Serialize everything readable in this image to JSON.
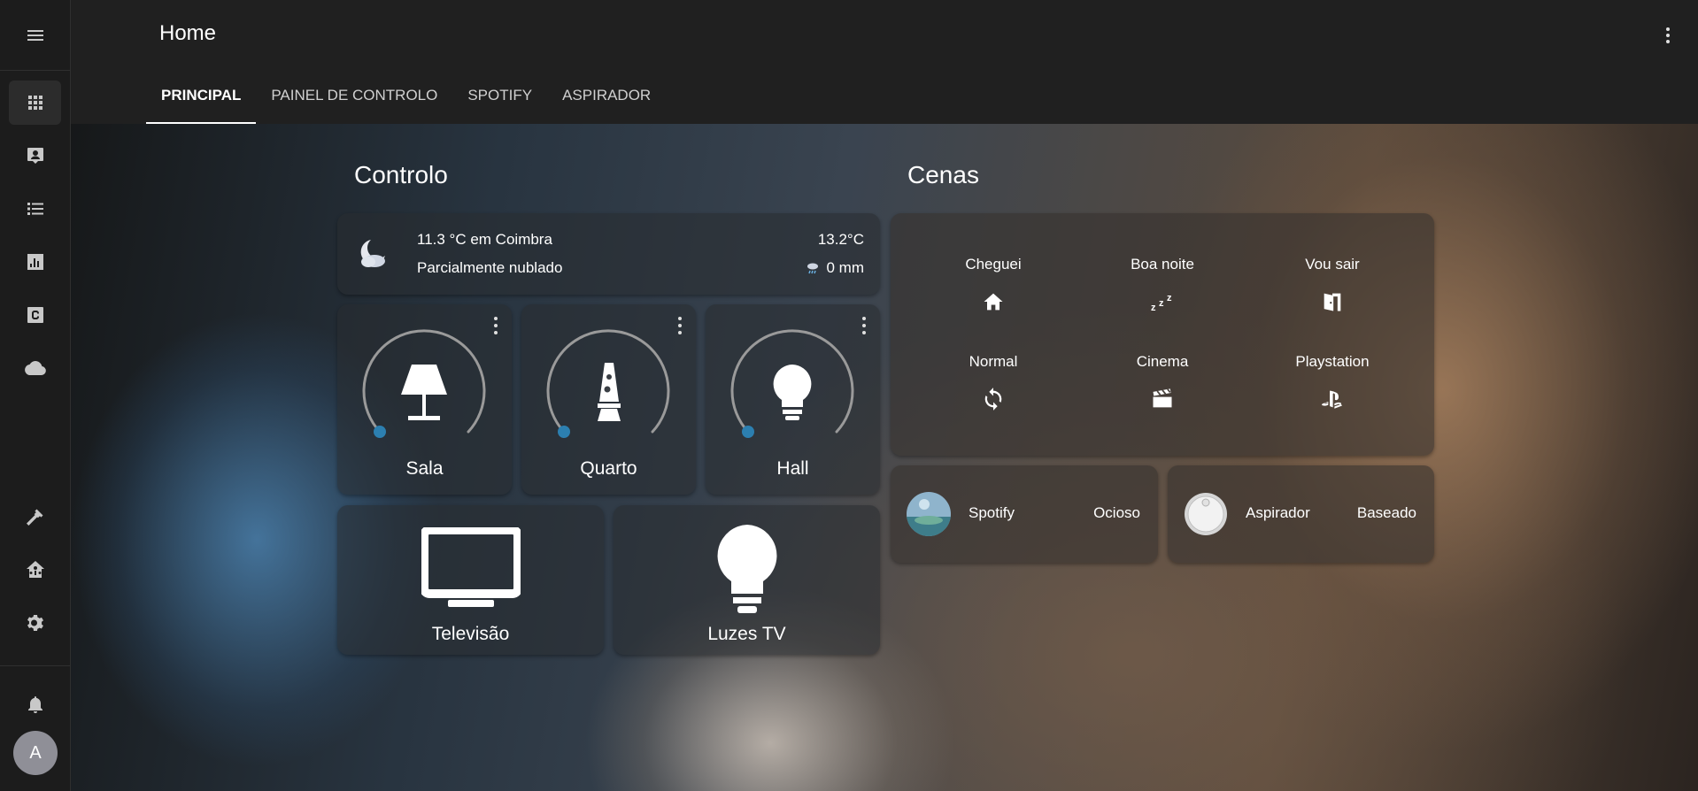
{
  "app": {
    "title": "Home"
  },
  "sidebar": {
    "menu_icon": "menu-icon",
    "items": [
      {
        "icon": "grid-icon",
        "active": true
      },
      {
        "icon": "person-board-icon"
      },
      {
        "icon": "list-icon"
      },
      {
        "icon": "bar-chart-icon"
      },
      {
        "icon": "c-box-icon"
      },
      {
        "icon": "cloud-icon"
      },
      {
        "icon": "hammer-icon"
      },
      {
        "icon": "home-assistant-icon"
      },
      {
        "icon": "gear-icon"
      },
      {
        "icon": "bell-icon"
      }
    ],
    "avatar_initial": "A"
  },
  "tabs": [
    {
      "label": "PRINCIPAL",
      "active": true
    },
    {
      "label": "PAINEL DE CONTROLO"
    },
    {
      "label": "SPOTIFY"
    },
    {
      "label": "ASPIRADOR"
    }
  ],
  "sections": {
    "control": "Controlo",
    "scenes": "Cenas"
  },
  "weather": {
    "location_temp": "11.3 °C em Coimbra",
    "condition": "Parcialmente nublado",
    "high": "13.2°C",
    "precipitation": "0 mm",
    "icon": "partly-cloudy-night-icon"
  },
  "lights": [
    {
      "name": "Sala",
      "icon": "floor-lamp-icon"
    },
    {
      "name": "Quarto",
      "icon": "lava-lamp-icon"
    },
    {
      "name": "Hall",
      "icon": "lightbulb-icon"
    }
  ],
  "buttons": [
    {
      "name": "Televisão",
      "icon": "television-icon"
    },
    {
      "name": "Luzes TV",
      "icon": "lightbulb-icon"
    }
  ],
  "scenes": [
    {
      "label": "Cheguei",
      "icon": "home-icon"
    },
    {
      "label": "Boa noite",
      "icon": "sleep-icon"
    },
    {
      "label": "Vou sair",
      "icon": "door-exit-icon"
    },
    {
      "label": "Normal",
      "icon": "refresh-icon"
    },
    {
      "label": "Cinema",
      "icon": "clapperboard-icon"
    },
    {
      "label": "Playstation",
      "icon": "playstation-icon"
    }
  ],
  "media": [
    {
      "name": "Spotify",
      "state": "Ocioso"
    },
    {
      "name": "Aspirador",
      "state": "Baseado"
    }
  ],
  "colors": {
    "accent": "#2c7fb0",
    "arc": "#9a9a9a"
  }
}
